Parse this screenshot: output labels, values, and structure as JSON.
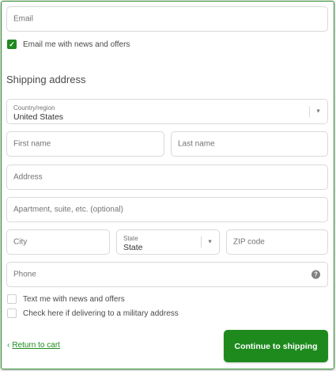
{
  "contact": {
    "email_placeholder": "Email",
    "email_news_label": "Email me with news and offers",
    "email_news_checked": true
  },
  "shipping": {
    "title": "Shipping address",
    "country_label": "Country/region",
    "country_value": "United States",
    "first_name_placeholder": "First name",
    "last_name_placeholder": "Last name",
    "address_placeholder": "Address",
    "apartment_placeholder": "Apartment, suite, etc. (optional)",
    "city_placeholder": "City",
    "state_label": "State",
    "state_value": "State",
    "zip_placeholder": "ZIP code",
    "phone_placeholder": "Phone",
    "text_news_label": "Text me with news and offers",
    "military_label": "Check here if delivering to a military address"
  },
  "actions": {
    "return_label": "Return to cart",
    "continue_label": "Continue to shipping"
  },
  "icons": {
    "check": "check-icon",
    "chevron": "chevron-down-icon",
    "help": "help-circle-icon",
    "back": "chevron-left-icon"
  },
  "colors": {
    "accent": "#1e8a1e",
    "border": "#d9d9d9"
  }
}
